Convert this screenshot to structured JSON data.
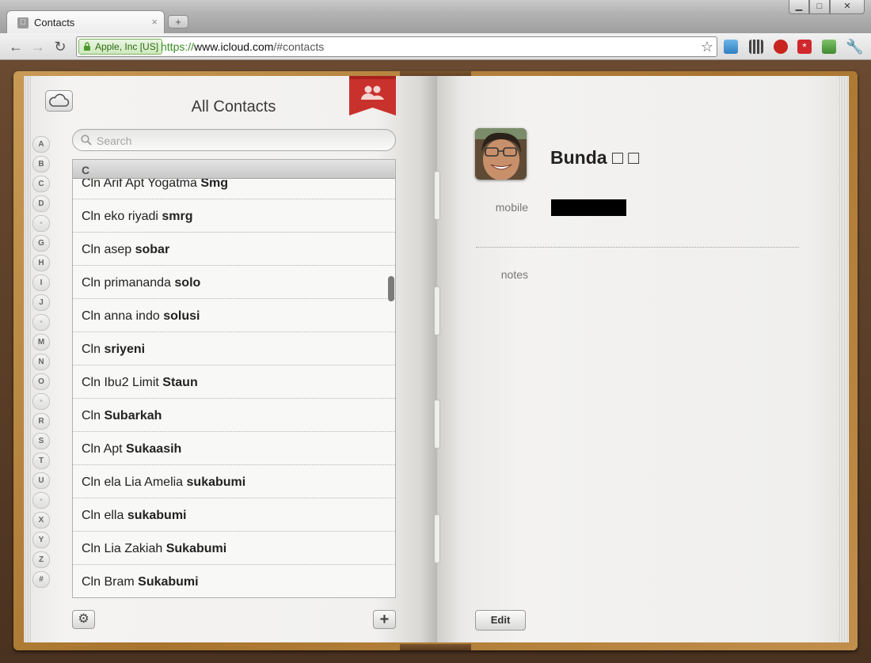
{
  "browser": {
    "tab_title": "Contacts",
    "new_tab_label": "+",
    "window_buttons": {
      "minimize": "▁",
      "maximize": "□",
      "close": "✕"
    },
    "security_badge": "Apple, Inc [US]",
    "url_scheme": "https://",
    "url_host": "www.icloud.com",
    "url_path": "/#contacts",
    "extension_icons": [
      "icloud-extension-icon",
      "qr-code-extension-icon",
      "adblock-extension-icon",
      "lastpass-extension-icon",
      "leaf-extension-icon",
      "wrench-menu-icon"
    ]
  },
  "sidebar": {
    "title": "All Contacts",
    "search_placeholder": "Search",
    "index_letters": [
      "A",
      "B",
      "C",
      "D",
      "•",
      "G",
      "H",
      "I",
      "J",
      "•",
      "M",
      "N",
      "O",
      "•",
      "R",
      "S",
      "T",
      "U",
      "•",
      "X",
      "Y",
      "Z",
      "#"
    ],
    "section_header": "C",
    "contacts": [
      {
        "first": "Cln Arif Apt Yogatma",
        "last": "Smg"
      },
      {
        "first": "Cln eko riyadi",
        "last": "smrg"
      },
      {
        "first": "Cln asep",
        "last": "sobar"
      },
      {
        "first": "Cln primananda",
        "last": "solo"
      },
      {
        "first": "Cln anna indo",
        "last": "solusi"
      },
      {
        "first": "Cln",
        "last": "sriyeni"
      },
      {
        "first": "Cln Ibu2 Limit",
        "last": "Staun"
      },
      {
        "first": "Cln",
        "last": "Subarkah"
      },
      {
        "first": "Cln Apt",
        "last": "Sukaasih"
      },
      {
        "first": "Cln ela Lia Amelia",
        "last": "sukabumi"
      },
      {
        "first": "Cln ella",
        "last": "sukabumi"
      },
      {
        "first": "Cln Lia Zakiah",
        "last": "Sukabumi"
      },
      {
        "first": "Cln Bram",
        "last": "Sukabumi"
      }
    ],
    "settings_button": "⚙",
    "add_button": "+"
  },
  "detail": {
    "name": "Bunda □ □",
    "mobile_label": "mobile",
    "notes_label": "notes",
    "edit_label": "Edit"
  },
  "colors": {
    "leather": "#a8742e",
    "ribbon": "#c9312c",
    "secure_green": "#3b8c22"
  }
}
